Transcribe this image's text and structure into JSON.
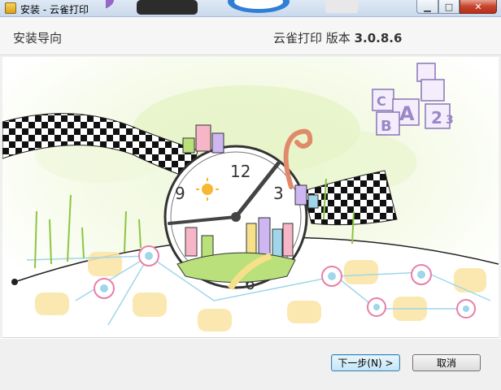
{
  "window": {
    "title": "安装 - 云雀打印",
    "buttons": [
      "minimize",
      "maximize",
      "close"
    ]
  },
  "header": {
    "left_text": "安装导向",
    "right_text": "云雀打印 版本",
    "version": "3.0.8.6"
  },
  "banner": {
    "clock_numbers": [
      "12",
      "3",
      "6",
      "9"
    ],
    "cube_letters": [
      "A",
      "B",
      "C",
      "2",
      "3"
    ]
  },
  "footer": {
    "next_label": "下一步(N) >",
    "cancel_label": "取消"
  },
  "colors": {
    "header_bg": "#f6f6f6",
    "window_bg": "#f0f0f0",
    "accent_button": "#3c7fb1"
  }
}
